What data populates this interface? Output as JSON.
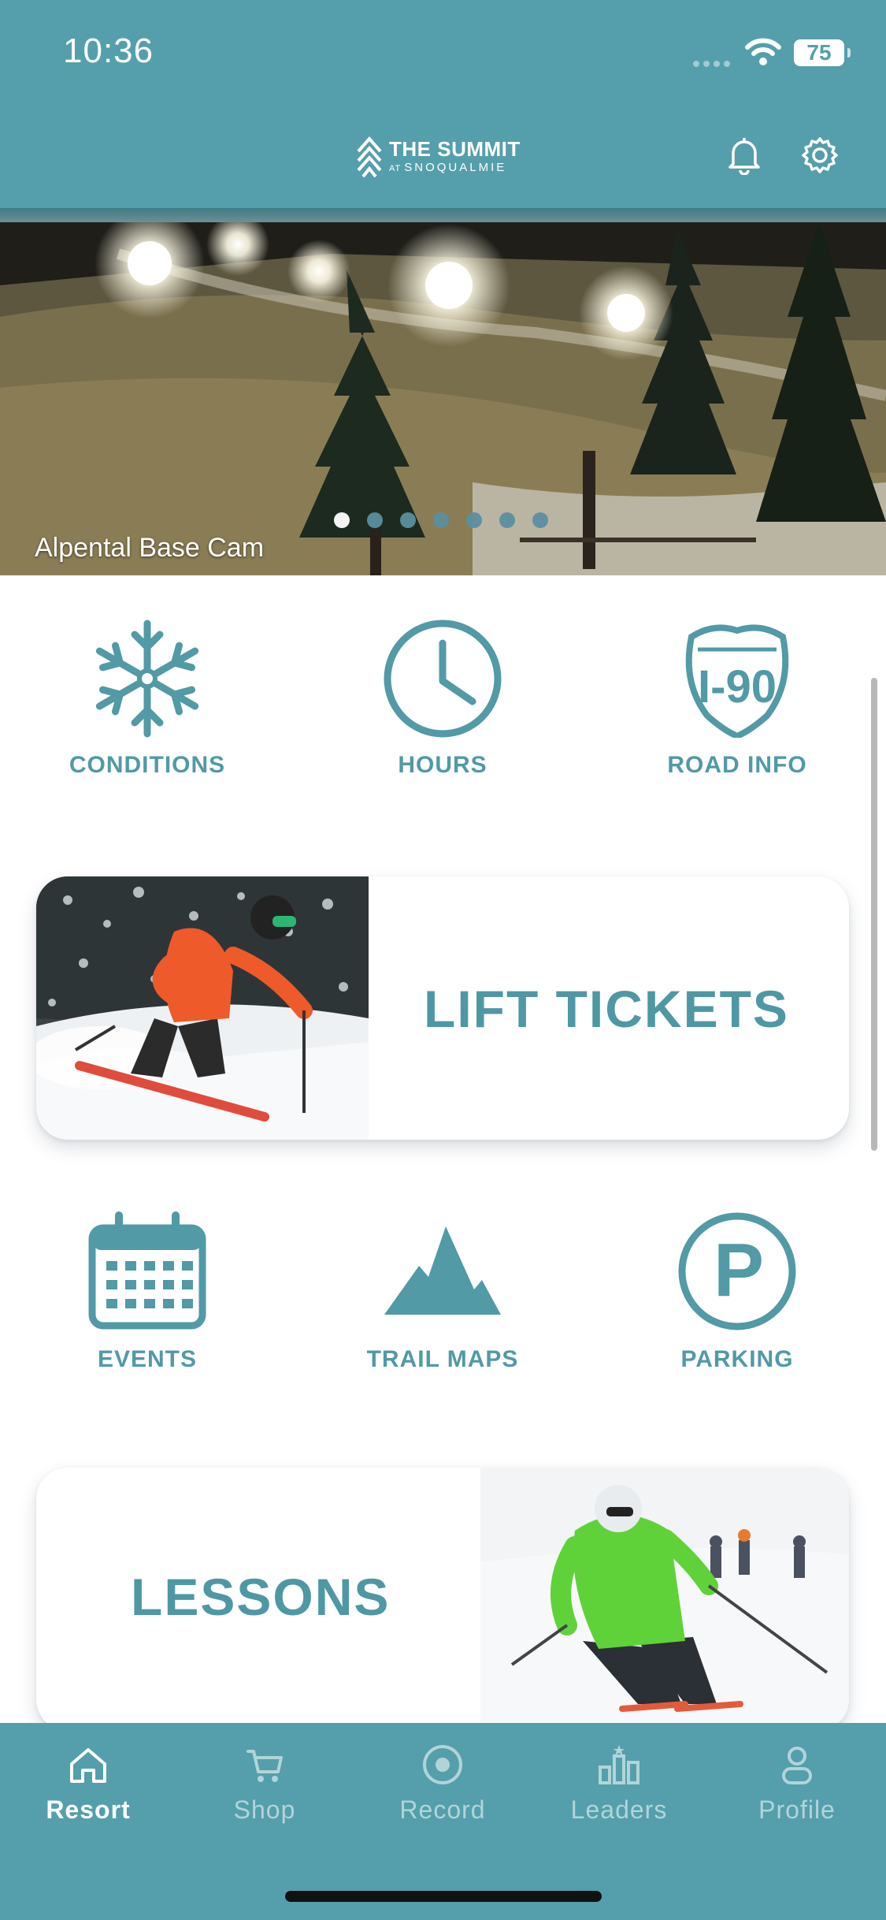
{
  "status_bar": {
    "time": "10:36",
    "battery": "75"
  },
  "header": {
    "brand_title": "THE SUMMIT",
    "brand_at": "AT",
    "brand_sub": "SNOQUALMIE",
    "icons": [
      "bell-icon",
      "gear-icon"
    ]
  },
  "hero": {
    "caption": "Alpental Base Cam",
    "slide_count": 7,
    "active_slide": 1
  },
  "tiles_row1": [
    {
      "label": "CONDITIONS",
      "icon": "snowflake-icon"
    },
    {
      "label": "HOURS",
      "icon": "clock-icon"
    },
    {
      "label": "ROAD INFO",
      "icon": "i90-shield-icon",
      "icon_text": "I-90"
    }
  ],
  "lift_tickets": {
    "label": "LIFT TICKETS"
  },
  "tiles_row2": [
    {
      "label": "EVENTS",
      "icon": "calendar-icon"
    },
    {
      "label": "TRAIL MAPS",
      "icon": "mountain-icon"
    },
    {
      "label": "PARKING",
      "icon": "parking-icon",
      "icon_text": "P"
    }
  ],
  "lessons": {
    "label": "LESSONS"
  },
  "tabbar": {
    "tabs": [
      {
        "label": "Resort",
        "icon": "home-icon",
        "active": true
      },
      {
        "label": "Shop",
        "icon": "cart-icon",
        "active": false
      },
      {
        "label": "Record",
        "icon": "record-icon",
        "active": false
      },
      {
        "label": "Leaders",
        "icon": "leaderboard-icon",
        "active": false
      },
      {
        "label": "Profile",
        "icon": "person-icon",
        "active": false
      }
    ]
  },
  "colors": {
    "brand": "#549fab",
    "accent_text": "#519aa6",
    "white": "#ffffff"
  }
}
